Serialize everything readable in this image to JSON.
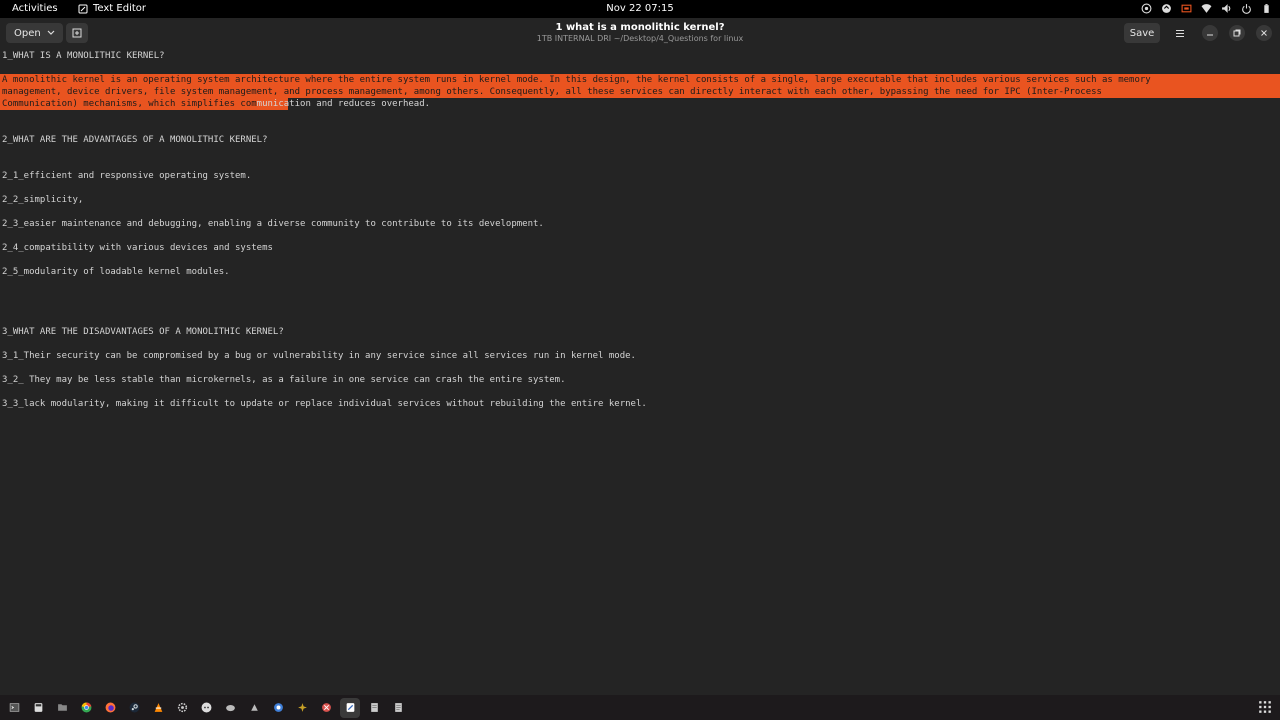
{
  "topbar": {
    "activities": "Activities",
    "app_name": "Text Editor",
    "clock": "Nov 22  07:15"
  },
  "header": {
    "open_label": "Open",
    "title": "1 what is a monolithic kernel?",
    "subtitle": "1TB INTERNAL DRI ~/Desktop/4_Questions for linux",
    "save_label": "Save"
  },
  "document": {
    "lines": [
      "1_WHAT IS A MONOLITHIC KERNEL?",
      "A monolithic kernel is an operating system architecture where the entire system runs in kernel mode. In this design, the kernel consists of a single, large executable that includes various services such as memory",
      "management, device drivers, file system management, and process management, among others. Consequently, all these services can directly interact with each other, bypassing the need for IPC (Inter-Process",
      "Communication) mechanisms, which simplifies com",
      "munication and reduces overhead.",
      "2_WHAT ARE THE ADVANTAGES OF A MONOLITHIC KERNEL?",
      "2_1_efficient and responsive operating system.",
      "2_2_simplicity,",
      "2_3_easier maintenance and debugging, enabling a diverse community to contribute to its development.",
      "2_4_compatibility with various devices and systems",
      "2_5_modularity of loadable kernel modules.",
      "3_WHAT ARE THE DISADVANTAGES OF A MONOLITHIC KERNEL?",
      "3_1_Their security can be compromised by a bug or vulnerability in any service since all services run in kernel mode.",
      "3_2_ They may be less stable than microkernels, as a failure in one service can crash the entire system.",
      "3_3_lack modularity, making it difficult to update or replace individual services without rebuilding the entire kernel."
    ]
  },
  "colors": {
    "selection": "#e95420",
    "background": "#242424",
    "topbar": "#000000"
  },
  "tray_icons": [
    "steam-tray-icon",
    "update-icon",
    "screen-share-icon",
    "wifi-icon",
    "volume-icon",
    "power-icon",
    "battery-icon"
  ],
  "dock_icons": [
    "terminal-icon",
    "calculator-icon",
    "files-icon",
    "chrome-icon",
    "firefox-icon",
    "steam-icon",
    "vlc-icon",
    "settings-icon",
    "discord-icon",
    "app-icon",
    "app-icon-2",
    "app-icon-3",
    "app-icon-4",
    "app-icon-5",
    "text-editor-icon",
    "document-icon",
    "document-icon-2",
    "show-apps-icon"
  ]
}
